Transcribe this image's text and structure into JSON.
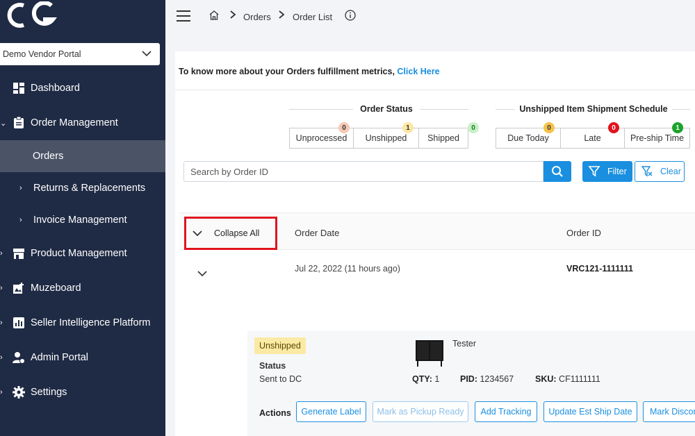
{
  "sidebar": {
    "vendor": "Demo Vendor Portal",
    "items": [
      {
        "label": "Dashboard"
      },
      {
        "label": "Order Management"
      },
      {
        "label": "Orders"
      },
      {
        "label": "Returns & Replacements"
      },
      {
        "label": "Invoice Management"
      },
      {
        "label": "Product Management"
      },
      {
        "label": "Muzeboard"
      },
      {
        "label": "Seller Intelligence Platform"
      },
      {
        "label": "Admin Portal"
      },
      {
        "label": "Settings"
      }
    ]
  },
  "breadcrumb": {
    "items": [
      "Orders",
      "Order List"
    ]
  },
  "metrics": {
    "text": "To know more about your Orders fulfillment metrics, ",
    "link": "Click Here"
  },
  "order_status": {
    "title": "Order Status",
    "items": [
      {
        "label": "Unprocessed",
        "count": "0",
        "color": "#f6c9b5"
      },
      {
        "label": "Unshipped",
        "count": "1",
        "color": "#fbe7a3"
      },
      {
        "label": "Shipped",
        "count": "0",
        "color": "#c8f0c8"
      }
    ]
  },
  "schedule": {
    "title": "Unshipped Item Shipment Schedule",
    "items": [
      {
        "label": "Due Today",
        "count": "0",
        "color": "#f5c34a"
      },
      {
        "label": "Late",
        "count": "0",
        "color": "#e0141d"
      },
      {
        "label": "Pre-ship Time",
        "count": "1",
        "color": "#1aa32b"
      }
    ]
  },
  "search": {
    "placeholder": "Search by Order ID",
    "filter_label": "Filter",
    "clear_label": "Clear"
  },
  "table": {
    "collapse_label": "Collapse All",
    "columns": [
      "Order Date",
      "Order ID"
    ]
  },
  "order": {
    "date": "Jul 22, 2022 (11 hours ago)",
    "id": "VRC121-1111111",
    "status_pill": "Unshipped",
    "status_label": "Status",
    "status_value": "Sent to DC",
    "product_name": "Tester",
    "qty_label": "QTY:",
    "qty": "1",
    "pid_label": "PID:",
    "pid": "1234567",
    "sku_label": "SKU:",
    "sku": "CF1111111",
    "actions_label": "Actions",
    "actions": [
      "Generate Label",
      "Mark as Pickup Ready",
      "Add Tracking",
      "Update Est Ship Date",
      "Mark Discor"
    ]
  },
  "colors": {
    "sidebar_bg": "#1f2a44",
    "accent": "#1a8fe0",
    "highlight_box": "#e0141d"
  }
}
